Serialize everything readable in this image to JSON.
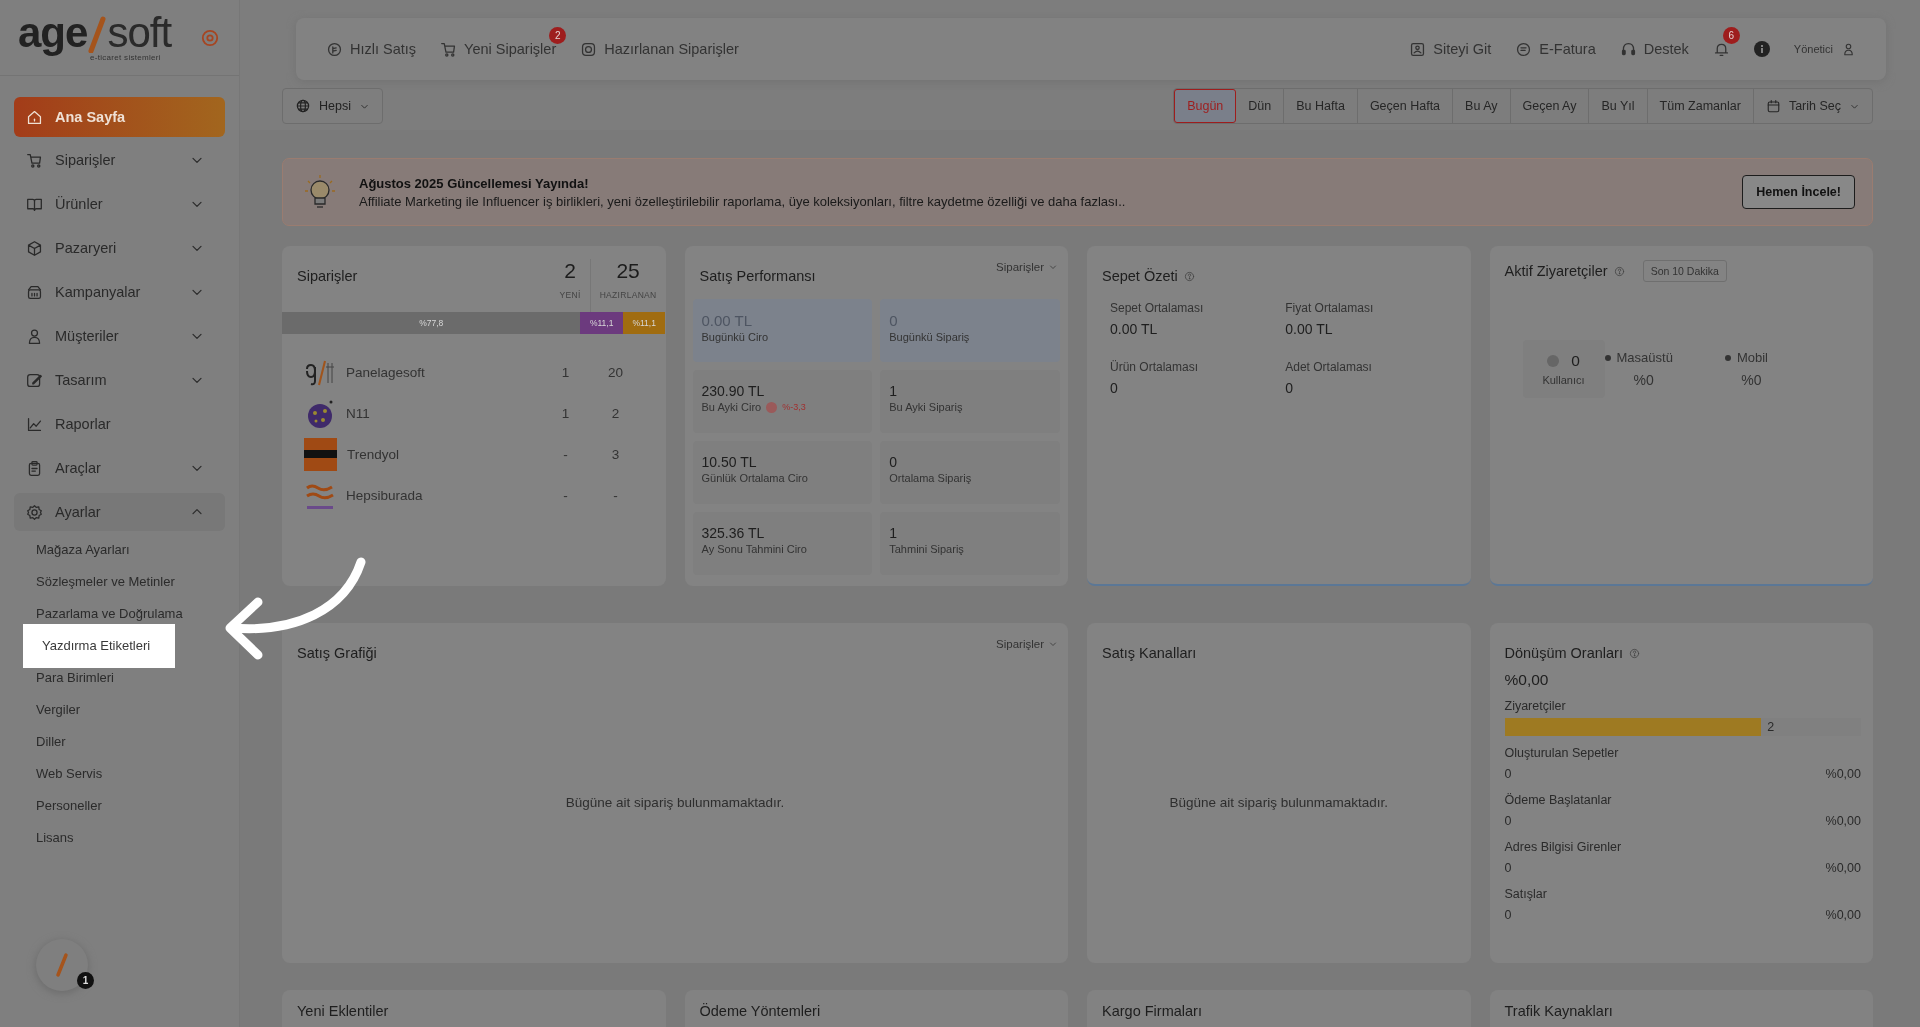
{
  "sidebar": {
    "logo": {
      "name_start": "age",
      "name_end": "soft",
      "tagline": "e-ticaret sistemleri"
    },
    "items": [
      {
        "label": "Ana Sayfa",
        "selected": true
      },
      {
        "label": "Siparişler",
        "selected": false,
        "expanded": false
      },
      {
        "label": "Ürünler",
        "selected": false,
        "expanded": false
      },
      {
        "label": "Pazaryeri",
        "selected": false,
        "expanded": false
      },
      {
        "label": "Kampanyalar",
        "selected": false,
        "expanded": false
      },
      {
        "label": "Müşteriler",
        "selected": false,
        "expanded": false
      },
      {
        "label": "Tasarım",
        "selected": false,
        "expanded": false
      },
      {
        "label": "Raporlar",
        "selected": false
      },
      {
        "label": "Araçlar",
        "selected": false,
        "expanded": false
      },
      {
        "label": "Ayarlar",
        "selected": false,
        "expanded": true,
        "children": [
          {
            "label": "Mağaza Ayarları",
            "highlighted": false
          },
          {
            "label": "Sözleşmeler ve Metinler",
            "highlighted": false
          },
          {
            "label": "Pazarlama ve Doğrulama",
            "highlighted": false
          },
          {
            "label": "Yazdırma Etiketleri",
            "highlighted": true
          },
          {
            "label": "Para Birimleri",
            "highlighted": false
          },
          {
            "label": "Vergiler",
            "highlighted": false
          },
          {
            "label": "Diller",
            "highlighted": false
          },
          {
            "label": "Web Servis",
            "highlighted": false
          },
          {
            "label": "Personeller",
            "highlighted": false
          },
          {
            "label": "Lisans",
            "highlighted": false
          }
        ]
      }
    ],
    "help_badge": "1"
  },
  "topbar": {
    "left": [
      {
        "label": "Hızlı Satış"
      },
      {
        "label": "Yeni Siparişler",
        "badge": "2"
      },
      {
        "label": "Hazırlanan Siparişler"
      }
    ],
    "right": [
      {
        "label": "Siteyi Git"
      },
      {
        "label": "E-Fatura"
      },
      {
        "label": "Destek"
      }
    ],
    "notifications_badge": "6",
    "user": "Yönetici"
  },
  "filters": {
    "store": "Hepsi",
    "ranges": [
      {
        "label": "Bugün",
        "selected": true
      },
      {
        "label": "Dün",
        "selected": false
      },
      {
        "label": "Bu Hafta",
        "selected": false
      },
      {
        "label": "Geçen Hafta",
        "selected": false
      },
      {
        "label": "Bu Ay",
        "selected": false
      },
      {
        "label": "Geçen Ay",
        "selected": false
      },
      {
        "label": "Bu Yıl",
        "selected": false
      },
      {
        "label": "Tüm Zamanlar",
        "selected": false
      }
    ],
    "date_picker": "Tarih Seç"
  },
  "banner": {
    "title": "Ağustos 2025 Güncellemesi Yayında!",
    "text": "Affiliate Marketing ile Influencer iş birlikleri, yeni özelleştirilebilir raporlama, üye koleksiyonları, filtre kaydetme özelliği ve daha fazlası..",
    "button": "Hemen İncele!"
  },
  "orders": {
    "title": "Siparişler",
    "new_count": "2",
    "new_label": "YENİ",
    "prepared_count": "25",
    "prepared_label": "HAZIRLANAN",
    "segments": [
      {
        "label": "%77,8",
        "color": "#6b6b6b"
      },
      {
        "label": "%11,1",
        "color": "#6c3a7e"
      },
      {
        "label": "%11,1",
        "color": "#a06c10"
      }
    ],
    "channels": [
      {
        "name": "Panelagesoft",
        "new": "1",
        "prepared": "20"
      },
      {
        "name": "N11",
        "new": "1",
        "prepared": "2"
      },
      {
        "name": "Trendyol",
        "new": "-",
        "prepared": "3"
      },
      {
        "name": "Hepsiburada",
        "new": "-",
        "prepared": "-"
      }
    ]
  },
  "performance": {
    "title": "Satış Performansı",
    "metric": "Siparişler",
    "tiles": [
      {
        "kind": "today",
        "value": "0.00 TL",
        "label": "Bugünkü Ciro"
      },
      {
        "kind": "today",
        "value": "0",
        "label": "Bugünkü Sipariş"
      },
      {
        "kind": "plain",
        "value": "230.90 TL",
        "label": "Bu Ayki Ciro",
        "change": "%-3,3"
      },
      {
        "kind": "plain",
        "value": "1",
        "label": "Bu Ayki Sipariş"
      },
      {
        "kind": "plain",
        "value": "10.50 TL",
        "label": "Günlük Ortalama Ciro"
      },
      {
        "kind": "plain",
        "value": "0",
        "label": "Ortalama Sipariş"
      },
      {
        "kind": "plain",
        "value": "325.36 TL",
        "label": "Ay Sonu Tahmini Ciro"
      },
      {
        "kind": "plain",
        "value": "1",
        "label": "Tahmini Sipariş"
      }
    ]
  },
  "basket": {
    "title": "Sepet Özeti",
    "stats": [
      {
        "label": "Sepet Ortalaması",
        "value": "0.00 TL"
      },
      {
        "label": "Fiyat Ortalaması",
        "value": "0.00 TL"
      },
      {
        "label": "Ürün Ortalaması",
        "value": "0"
      },
      {
        "label": "Adet Ortalaması",
        "value": "0"
      }
    ]
  },
  "visitors": {
    "title": "Aktif Ziyaretçiler",
    "period": "Son 10 Dakika",
    "users": "0",
    "users_label": "Kullanıcı",
    "devices": [
      {
        "label": "Masaüstü",
        "value": "%0"
      },
      {
        "label": "Mobil",
        "value": "%0"
      }
    ]
  },
  "sales_chart": {
    "title": "Satış Grafiği",
    "metric": "Siparişler",
    "empty": "Bügüne ait sipariş bulunmamaktadır."
  },
  "sales_channels": {
    "title": "Satış Kanalları",
    "empty": "Bügüne ait sipariş bulunmamaktadır."
  },
  "conversion": {
    "title": "Dönüşüm Oranları",
    "rate": "%0,00",
    "steps": [
      {
        "label": "Ziyaretçiler",
        "value": "2",
        "level": 0.72
      },
      {
        "label": "Oluşturulan Sepetler",
        "value": "0",
        "percent": "%0,00"
      },
      {
        "label": "Ödeme Başlatanlar",
        "value": "0",
        "percent": "%0,00"
      },
      {
        "label": "Adres Bilgisi Girenler",
        "value": "0",
        "percent": "%0,00"
      },
      {
        "label": "Satışlar",
        "value": "0",
        "percent": "%0,00"
      }
    ]
  },
  "more_cards": [
    "Yeni Eklentiler",
    "Ödeme Yöntemleri",
    "Kargo Firmaları",
    "Trafik Kaynakları"
  ]
}
